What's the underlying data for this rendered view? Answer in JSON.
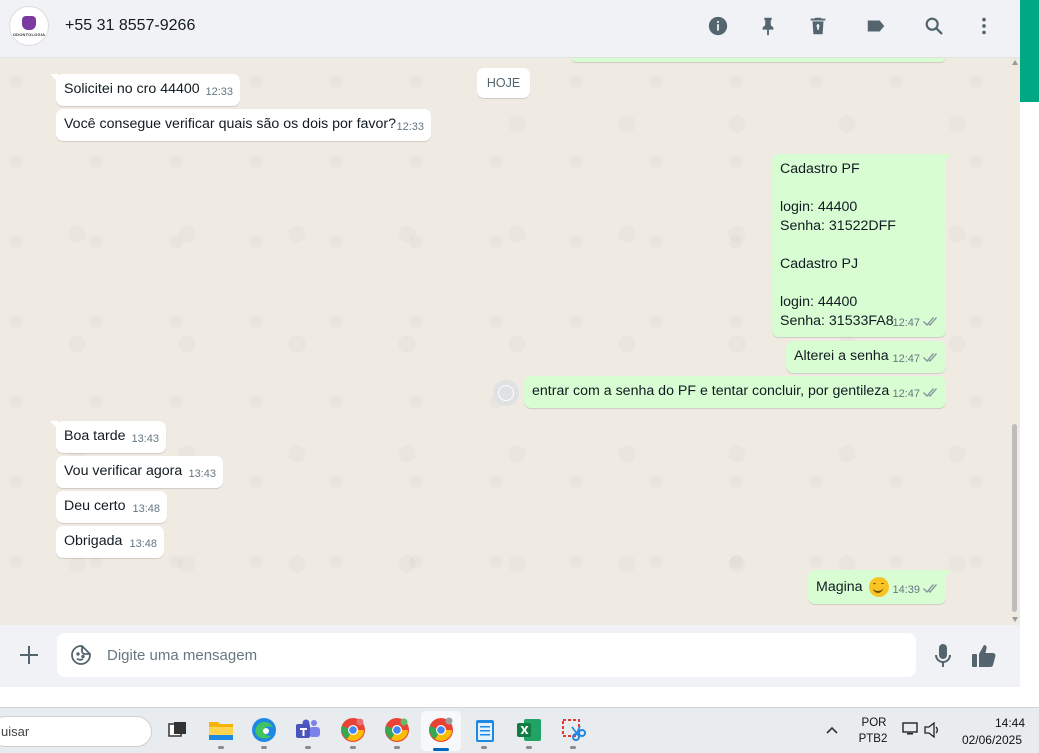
{
  "header": {
    "contact_name": "+55 31 8557-9266",
    "avatar_text": "ODONTOLOGIA",
    "icons": [
      "info-icon",
      "pin-icon",
      "delete-icon",
      "label-icon",
      "search-icon",
      "more-vertical-icon"
    ]
  },
  "chat": {
    "date_label": "HOJE",
    "messages": [
      {
        "dir": "in",
        "text": "Solicitei no cro 44400",
        "time": "12:33"
      },
      {
        "dir": "in",
        "text": "Você consegue verificar quais são os dois por favor?",
        "time": "12:33"
      },
      {
        "dir": "out",
        "text": "Cadastro PF\n\nlogin: 44400\nSenha: 31522DFF\n\nCadastro PJ\n\nlogin: 44400\nSenha: 31533FA8",
        "time": "12:47",
        "status": "read"
      },
      {
        "dir": "out",
        "text": "Alterei a senha",
        "time": "12:47",
        "status": "read"
      },
      {
        "dir": "out",
        "text": "entrar com a senha do PF e tentar concluir, por gentileza",
        "time": "12:47",
        "status": "read"
      },
      {
        "dir": "in",
        "text": "Boa tarde",
        "time": "13:43"
      },
      {
        "dir": "in",
        "text": "Vou verificar agora",
        "time": "13:43"
      },
      {
        "dir": "in",
        "text": "Deu certo",
        "time": "13:48"
      },
      {
        "dir": "in",
        "text": "Obrigada",
        "time": "13:48"
      },
      {
        "dir": "out",
        "text": "Magina",
        "emoji": "smiling-face",
        "time": "14:39",
        "status": "read"
      }
    ]
  },
  "composer": {
    "placeholder": "Digite uma mensagem"
  },
  "taskbar": {
    "search_text": "uisar",
    "lang_line1": "POR",
    "lang_line2": "PTB2",
    "time": "14:44",
    "date": "02/06/2025"
  },
  "colors": {
    "accent": "#00a884",
    "incoming_bubble": "#ffffff",
    "outgoing_bubble": "#d9fdd3",
    "chat_bg": "#efeae2"
  }
}
